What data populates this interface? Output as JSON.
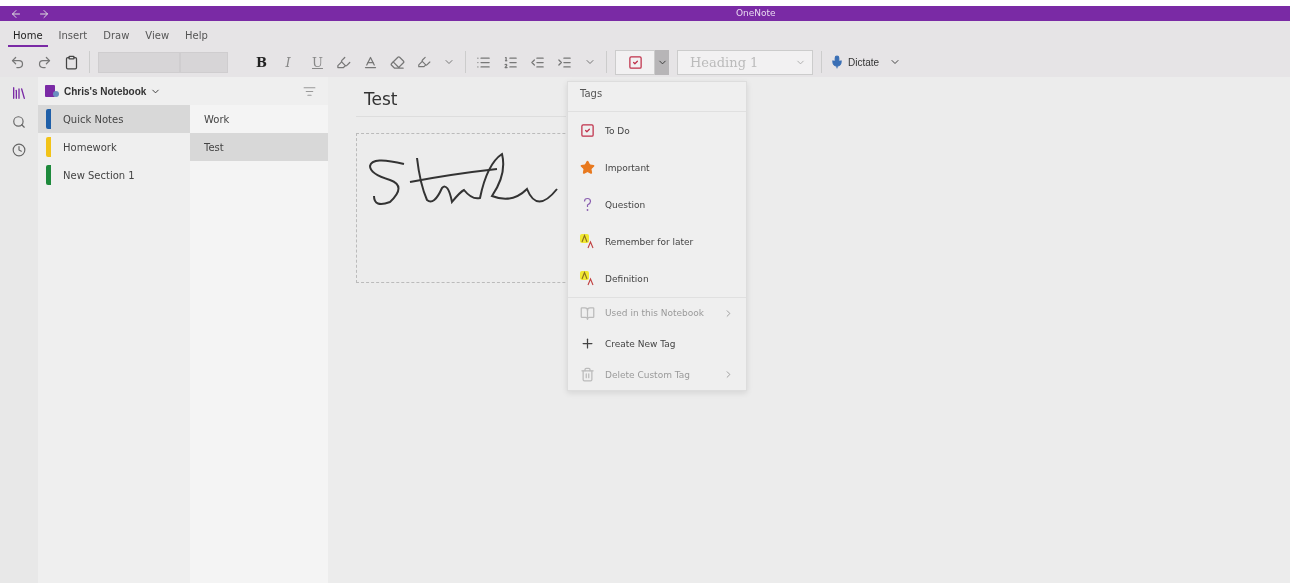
{
  "window": {
    "title": "OneNote"
  },
  "ribbon_tabs": [
    {
      "label": "Home",
      "selected": true
    },
    {
      "label": "Insert",
      "selected": false
    },
    {
      "label": "Draw",
      "selected": false
    },
    {
      "label": "View",
      "selected": false
    },
    {
      "label": "Help",
      "selected": false
    }
  ],
  "format_buttons": [
    {
      "label": "B",
      "kind": "bold"
    },
    {
      "label": "I",
      "kind": "italic"
    },
    {
      "label": "U",
      "kind": "underline"
    }
  ],
  "style_dropdown": {
    "value": "Heading 1",
    "disabled": true
  },
  "dictate_button": {
    "label": "Dictate"
  },
  "notebook": {
    "name": "Chris's Notebook"
  },
  "sections": [
    {
      "label": "Quick Notes",
      "color": "#1f5fa8",
      "selected": true
    },
    {
      "label": "Homework",
      "color": "#f2c318",
      "selected": false
    },
    {
      "label": "New Section 1",
      "color": "#1e8a3c",
      "selected": false
    }
  ],
  "pages": [
    {
      "label": "Work",
      "selected": false
    },
    {
      "label": "Test",
      "selected": true
    }
  ],
  "page": {
    "title": "Test"
  },
  "tags_menu": {
    "title": "Tags",
    "items": [
      {
        "label": "To Do",
        "kind": "todo",
        "disabled": false,
        "submenu": false
      },
      {
        "label": "Important",
        "kind": "star",
        "disabled": false,
        "submenu": false
      },
      {
        "label": "Question",
        "kind": "question",
        "disabled": false,
        "submenu": false
      },
      {
        "label": "Remember for later",
        "kind": "highlight",
        "disabled": false,
        "submenu": false
      },
      {
        "label": "Definition",
        "kind": "highlight",
        "disabled": false,
        "submenu": false
      },
      {
        "label": "Used in this Notebook",
        "kind": "book",
        "disabled": true,
        "submenu": true
      },
      {
        "label": "Create New Tag",
        "kind": "plus",
        "disabled": false,
        "submenu": false
      },
      {
        "label": "Delete Custom Tag",
        "kind": "trash",
        "disabled": true,
        "submenu": true
      }
    ]
  }
}
